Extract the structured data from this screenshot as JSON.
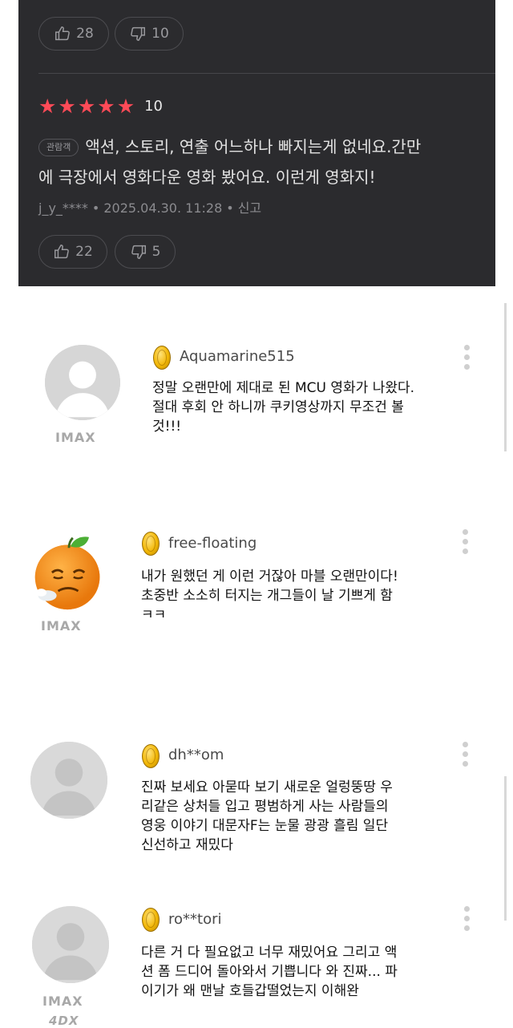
{
  "top_review": {
    "likes": "28",
    "dislikes": "10"
  },
  "review": {
    "score": "10",
    "star_count": 5,
    "viewer_badge": "관람객",
    "text_line1": "액션, 스토리, 연출 어느하나 빠지는게 없네요.간만",
    "text_line2": "에 극장에서 영화다운 영화 봤어요. 이런게 영화지!",
    "author": "j_y_****",
    "date": "2025.04.30. 11:28",
    "report": "신고",
    "likes": "22",
    "dislikes": "5"
  },
  "colors": {
    "panel_bg": "#2b2b2e",
    "star": "#ff4a57",
    "coin": "#f2b705"
  },
  "comments": [
    {
      "username": "Aquamarine515",
      "format": "IMAX",
      "avatar": "default-user-avatar",
      "lines": [
        "정말 오랜만에 제대로 된 MCU 영화가 나왔다.",
        "절대 후회 안 하니까 쿠키영상까지 무조건 볼",
        "것!!!"
      ]
    },
    {
      "username": "free-floating",
      "format": "IMAX",
      "avatar": "tired-tangerine-emoji",
      "lines": [
        "내가 원했던 게 이런 거잖아 마블 오랜만이다!",
        "초중반 소소히 터지는 개그들이 날 기쁘게 함",
        "ㅋㅋ"
      ]
    },
    {
      "username": "dh**om",
      "format": "",
      "avatar": "default-user-avatar",
      "lines": [
        "진짜 보세요 아묻따 보기 새로운 얼렁뚱땅 우",
        "리같은 상처들 입고 평범하게 사는 사람들의",
        "영웅 이야기 대문자F는 눈물 광광 흘림 일단",
        "신선하고 재밌다"
      ]
    },
    {
      "username": "ro**tori",
      "format": "IMAX",
      "format2": "4DX",
      "avatar": "default-user-avatar",
      "lines": [
        "다른 거 다 필요없고 너무 재밌어요 그리고 액",
        "션 폼 드디어 돌아와서 기쁩니다 와 진짜... 파",
        "이기가 왜 맨날 호들갑떨었는지 이해완"
      ]
    }
  ]
}
